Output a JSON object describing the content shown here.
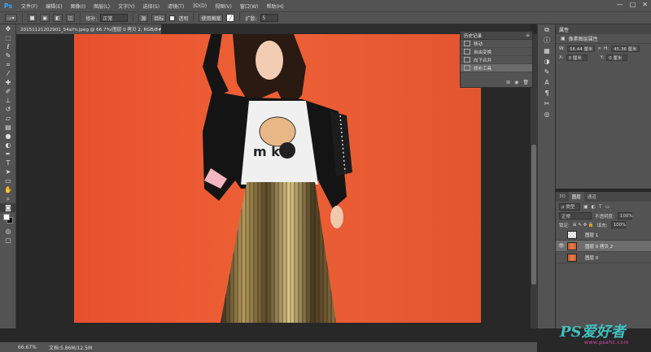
{
  "app": {
    "logo": "Ps"
  },
  "menu": [
    "文件(F)",
    "编辑(E)",
    "图像(I)",
    "图层(L)",
    "文字(Y)",
    "选择(S)",
    "滤镜(T)",
    "3D(D)",
    "视图(V)",
    "窗口(W)",
    "帮助(H)"
  ],
  "window_controls": [
    "—",
    "□",
    "✕"
  ],
  "options": {
    "feather_label": "修补:",
    "mode_value": "正常",
    "source_label": "源",
    "target_label": "目标",
    "transparent_label": "透明",
    "use_pattern_label": "使用图案",
    "diffusion_label": "扩散:",
    "diffusion_value": "5"
  },
  "document": {
    "tab_title": "20151121202901_54aYn.jpeg @ 66.7%(图层 0 拷贝 2, RGB/8#) *",
    "tab_close": "×"
  },
  "history": {
    "tab": "历史记录",
    "items": [
      "移动",
      "自由变换",
      "向下合并",
      "修补工具"
    ],
    "active_index": 3,
    "footer_icons": [
      "new-document-icon",
      "camera-icon",
      "trash-icon"
    ]
  },
  "properties": {
    "title": "属性",
    "subtitle": "像素图层属性",
    "w_label": "W:",
    "w_value": "56.44 厘米",
    "h_label": "H:",
    "h_value": "45.36 厘米",
    "x_label": "X:",
    "x_value": "0 厘米",
    "y_label": "Y:",
    "y_value": "0 厘米"
  },
  "layers_panel": {
    "tabs": [
      "3D",
      "图层",
      "通道"
    ],
    "active_tab": 1,
    "filter": "ρ 类型",
    "blend_mode": "正常",
    "opacity_label": "不透明度:",
    "opacity_value": "100%",
    "lock_label": "锁定:",
    "fill_label": "填充:",
    "fill_value": "100%",
    "layers": [
      {
        "name": "图层 1",
        "visible": false,
        "thumb": "checker"
      },
      {
        "name": "图层 0 拷贝 2",
        "visible": true,
        "thumb": "photo",
        "selected": true
      },
      {
        "name": "图层 0",
        "visible": false,
        "thumb": "photo"
      }
    ]
  },
  "status": {
    "zoom": "66.67%",
    "doc_size": "文档:5.86M/12.5M"
  },
  "watermark": {
    "main": "PS爱好者",
    "url": "www.psahz.com"
  }
}
